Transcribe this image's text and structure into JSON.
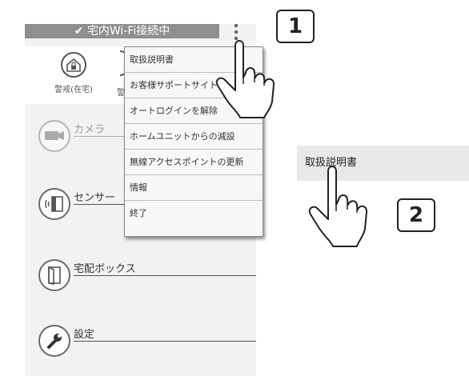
{
  "status_bar": {
    "text": "✔ 宅内Wi-Fi接続中"
  },
  "tabs": [
    {
      "label": "警戒(在宅)",
      "icon": "home-lock-icon"
    },
    {
      "label": "警",
      "icon": "lock-icon"
    }
  ],
  "list_items": [
    {
      "label": "カメラ",
      "icon": "camera-icon"
    },
    {
      "label": "センサー",
      "icon": "door-sensor-icon"
    },
    {
      "label": "宅配ボックス",
      "icon": "delivery-box-icon"
    },
    {
      "label": "設定",
      "icon": "wrench-icon"
    }
  ],
  "menu": {
    "items": [
      "取扱説明書",
      "お客様サポートサイト",
      "オートログインを解除",
      "ホームユニットからの減設",
      "無線アクセスポイントの更新",
      "情報",
      "終了"
    ]
  },
  "steps": {
    "step1": "1",
    "step2": "2"
  },
  "zoom": {
    "label": "取扱説明書"
  },
  "colors": {
    "status_bar": "#8f8f8f",
    "panel": "#f2f2f2",
    "menu": "#f7f7f7"
  }
}
